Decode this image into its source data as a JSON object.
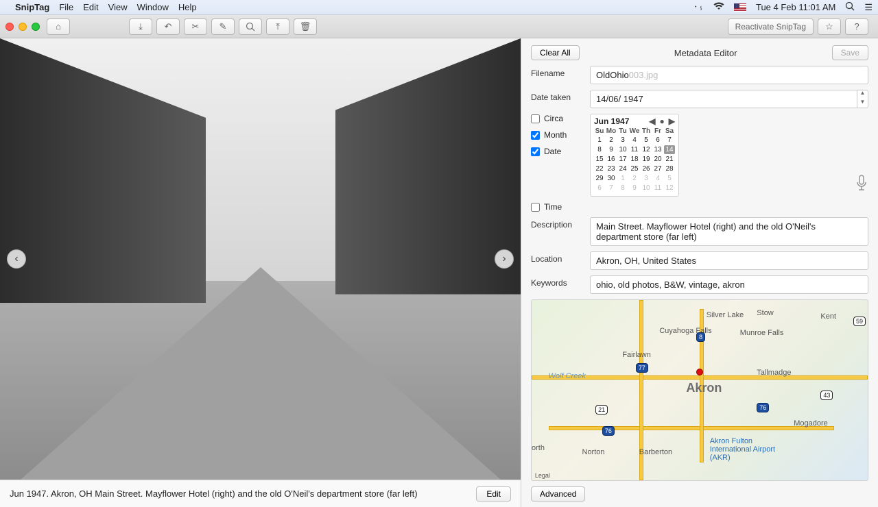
{
  "menubar": {
    "app": "SnipTag",
    "items": [
      "File",
      "Edit",
      "View",
      "Window",
      "Help"
    ],
    "clock": "Tue 4 Feb  11:01 AM"
  },
  "toolbar": {
    "reactivate": "Reactivate SnipTag"
  },
  "image": {
    "caption": "Jun 1947. Akron, OH Main Street. Mayflower Hotel (right) and the old O'Neil's department store (far left)",
    "edit": "Edit"
  },
  "meta": {
    "clear": "Clear All",
    "title": "Metadata Editor",
    "save": "Save",
    "labels": {
      "filename": "Filename",
      "datetaken": "Date taken",
      "circa": "Circa",
      "month": "Month",
      "date": "Date",
      "time": "Time",
      "description": "Description",
      "location": "Location",
      "keywords": "Keywords",
      "advanced": "Advanced"
    },
    "filename_val": "OldOhio",
    "filename_ghost": "003.jpg",
    "datetaken_val": "14/06/ 1947",
    "calendar": {
      "title": "Jun 1947",
      "dow": [
        "Su",
        "Mo",
        "Tu",
        "We",
        "Th",
        "Fr",
        "Sa"
      ],
      "weeks": [
        [
          {
            "n": 1
          },
          {
            "n": 2
          },
          {
            "n": 3
          },
          {
            "n": 4
          },
          {
            "n": 5
          },
          {
            "n": 6
          },
          {
            "n": 7
          }
        ],
        [
          {
            "n": 8
          },
          {
            "n": 9
          },
          {
            "n": 10
          },
          {
            "n": 11
          },
          {
            "n": 12
          },
          {
            "n": 13
          },
          {
            "n": 14,
            "sel": true
          }
        ],
        [
          {
            "n": 15
          },
          {
            "n": 16
          },
          {
            "n": 17
          },
          {
            "n": 18
          },
          {
            "n": 19
          },
          {
            "n": 20
          },
          {
            "n": 21
          }
        ],
        [
          {
            "n": 22
          },
          {
            "n": 23
          },
          {
            "n": 24
          },
          {
            "n": 25
          },
          {
            "n": 26
          },
          {
            "n": 27
          },
          {
            "n": 28
          }
        ],
        [
          {
            "n": 29
          },
          {
            "n": 30
          },
          {
            "n": 1,
            "out": true
          },
          {
            "n": 2,
            "out": true
          },
          {
            "n": 3,
            "out": true
          },
          {
            "n": 4,
            "out": true
          },
          {
            "n": 5,
            "out": true
          }
        ],
        [
          {
            "n": 6,
            "out": true
          },
          {
            "n": 7,
            "out": true
          },
          {
            "n": 8,
            "out": true
          },
          {
            "n": 9,
            "out": true
          },
          {
            "n": 10,
            "out": true
          },
          {
            "n": 11,
            "out": true
          },
          {
            "n": 12,
            "out": true
          }
        ]
      ]
    },
    "description_val": "Main Street. Mayflower Hotel (right) and the old O'Neil's department store (far left)",
    "location_val": "Akron, OH, United States",
    "keywords_val": "ohio, old photos, B&W, vintage, akron",
    "map": {
      "center": "Akron",
      "labels": [
        "Silver Lake",
        "Stow",
        "Kent",
        "Cuyahoga Falls",
        "Munroe Falls",
        "Fairlawn",
        "Tallmadge",
        "Mogadore",
        "Norton",
        "Barberton",
        "Akron Fulton International Airport (AKR)",
        "Legal",
        "orth",
        "Wolf Creek"
      ],
      "shields": [
        "77",
        "76",
        "76",
        "8",
        "59",
        "21",
        "43"
      ]
    }
  }
}
